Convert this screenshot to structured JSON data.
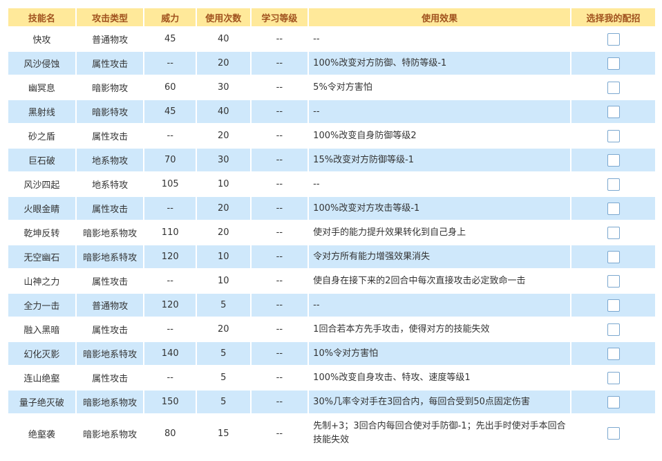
{
  "headers": [
    "技能名",
    "攻击类型",
    "威力",
    "使用次数",
    "学习等级",
    "使用效果",
    "选择我的配招"
  ],
  "rows": [
    {
      "name": "快攻",
      "type": "普通物攻",
      "power": "45",
      "pp": "40",
      "level": "--",
      "effect": "--"
    },
    {
      "name": "风沙侵蚀",
      "type": "属性攻击",
      "power": "--",
      "pp": "20",
      "level": "--",
      "effect": "100%改变对方防御、特防等级-1"
    },
    {
      "name": "幽冥息",
      "type": "暗影物攻",
      "power": "60",
      "pp": "30",
      "level": "--",
      "effect": "5%令对方害怕"
    },
    {
      "name": "黑射线",
      "type": "暗影特攻",
      "power": "45",
      "pp": "40",
      "level": "--",
      "effect": "--"
    },
    {
      "name": "砂之盾",
      "type": "属性攻击",
      "power": "--",
      "pp": "20",
      "level": "--",
      "effect": "100%改变自身防御等级2"
    },
    {
      "name": "巨石破",
      "type": "地系物攻",
      "power": "70",
      "pp": "30",
      "level": "--",
      "effect": "15%改变对方防御等级-1"
    },
    {
      "name": "风沙四起",
      "type": "地系特攻",
      "power": "105",
      "pp": "10",
      "level": "--",
      "effect": "--"
    },
    {
      "name": "火眼金睛",
      "type": "属性攻击",
      "power": "--",
      "pp": "20",
      "level": "--",
      "effect": "100%改变对方攻击等级-1"
    },
    {
      "name": "乾坤反转",
      "type": "暗影地系物攻",
      "power": "110",
      "pp": "20",
      "level": "--",
      "effect": "使对手的能力提升效果转化到自己身上"
    },
    {
      "name": "无空幽石",
      "type": "暗影地系特攻",
      "power": "120",
      "pp": "10",
      "level": "--",
      "effect": "令对方所有能力增强效果消失"
    },
    {
      "name": "山神之力",
      "type": "属性攻击",
      "power": "--",
      "pp": "10",
      "level": "--",
      "effect": "使自身在接下来的2回合中每次直接攻击必定致命一击"
    },
    {
      "name": "全力一击",
      "type": "普通物攻",
      "power": "120",
      "pp": "5",
      "level": "--",
      "effect": "--"
    },
    {
      "name": "融入黑暗",
      "type": "属性攻击",
      "power": "--",
      "pp": "20",
      "level": "--",
      "effect": "1回合若本方先手攻击，使得对方的技能失效"
    },
    {
      "name": "幻化灭影",
      "type": "暗影地系特攻",
      "power": "140",
      "pp": "5",
      "level": "--",
      "effect": "10%令对方害怕"
    },
    {
      "name": "连山绝壑",
      "type": "属性攻击",
      "power": "--",
      "pp": "5",
      "level": "--",
      "effect": "100%改变自身攻击、特攻、速度等级1"
    },
    {
      "name": "量子绝灭破",
      "type": "暗影地系物攻",
      "power": "150",
      "pp": "5",
      "level": "--",
      "effect": "30%几率令对手在3回合内，每回合受到50点固定伤害"
    },
    {
      "name": "绝壑袭",
      "type": "暗影地系物攻",
      "power": "80",
      "pp": "15",
      "level": "--",
      "effect": "先制+3；3回合内每回合使对手防御-1；先出手时使对手本回合技能失效"
    }
  ],
  "colors": {
    "header_bg": "#ffe99a",
    "header_text": "#a0521e",
    "row_alt": "#cfe8fb",
    "row": "#ffffff"
  }
}
